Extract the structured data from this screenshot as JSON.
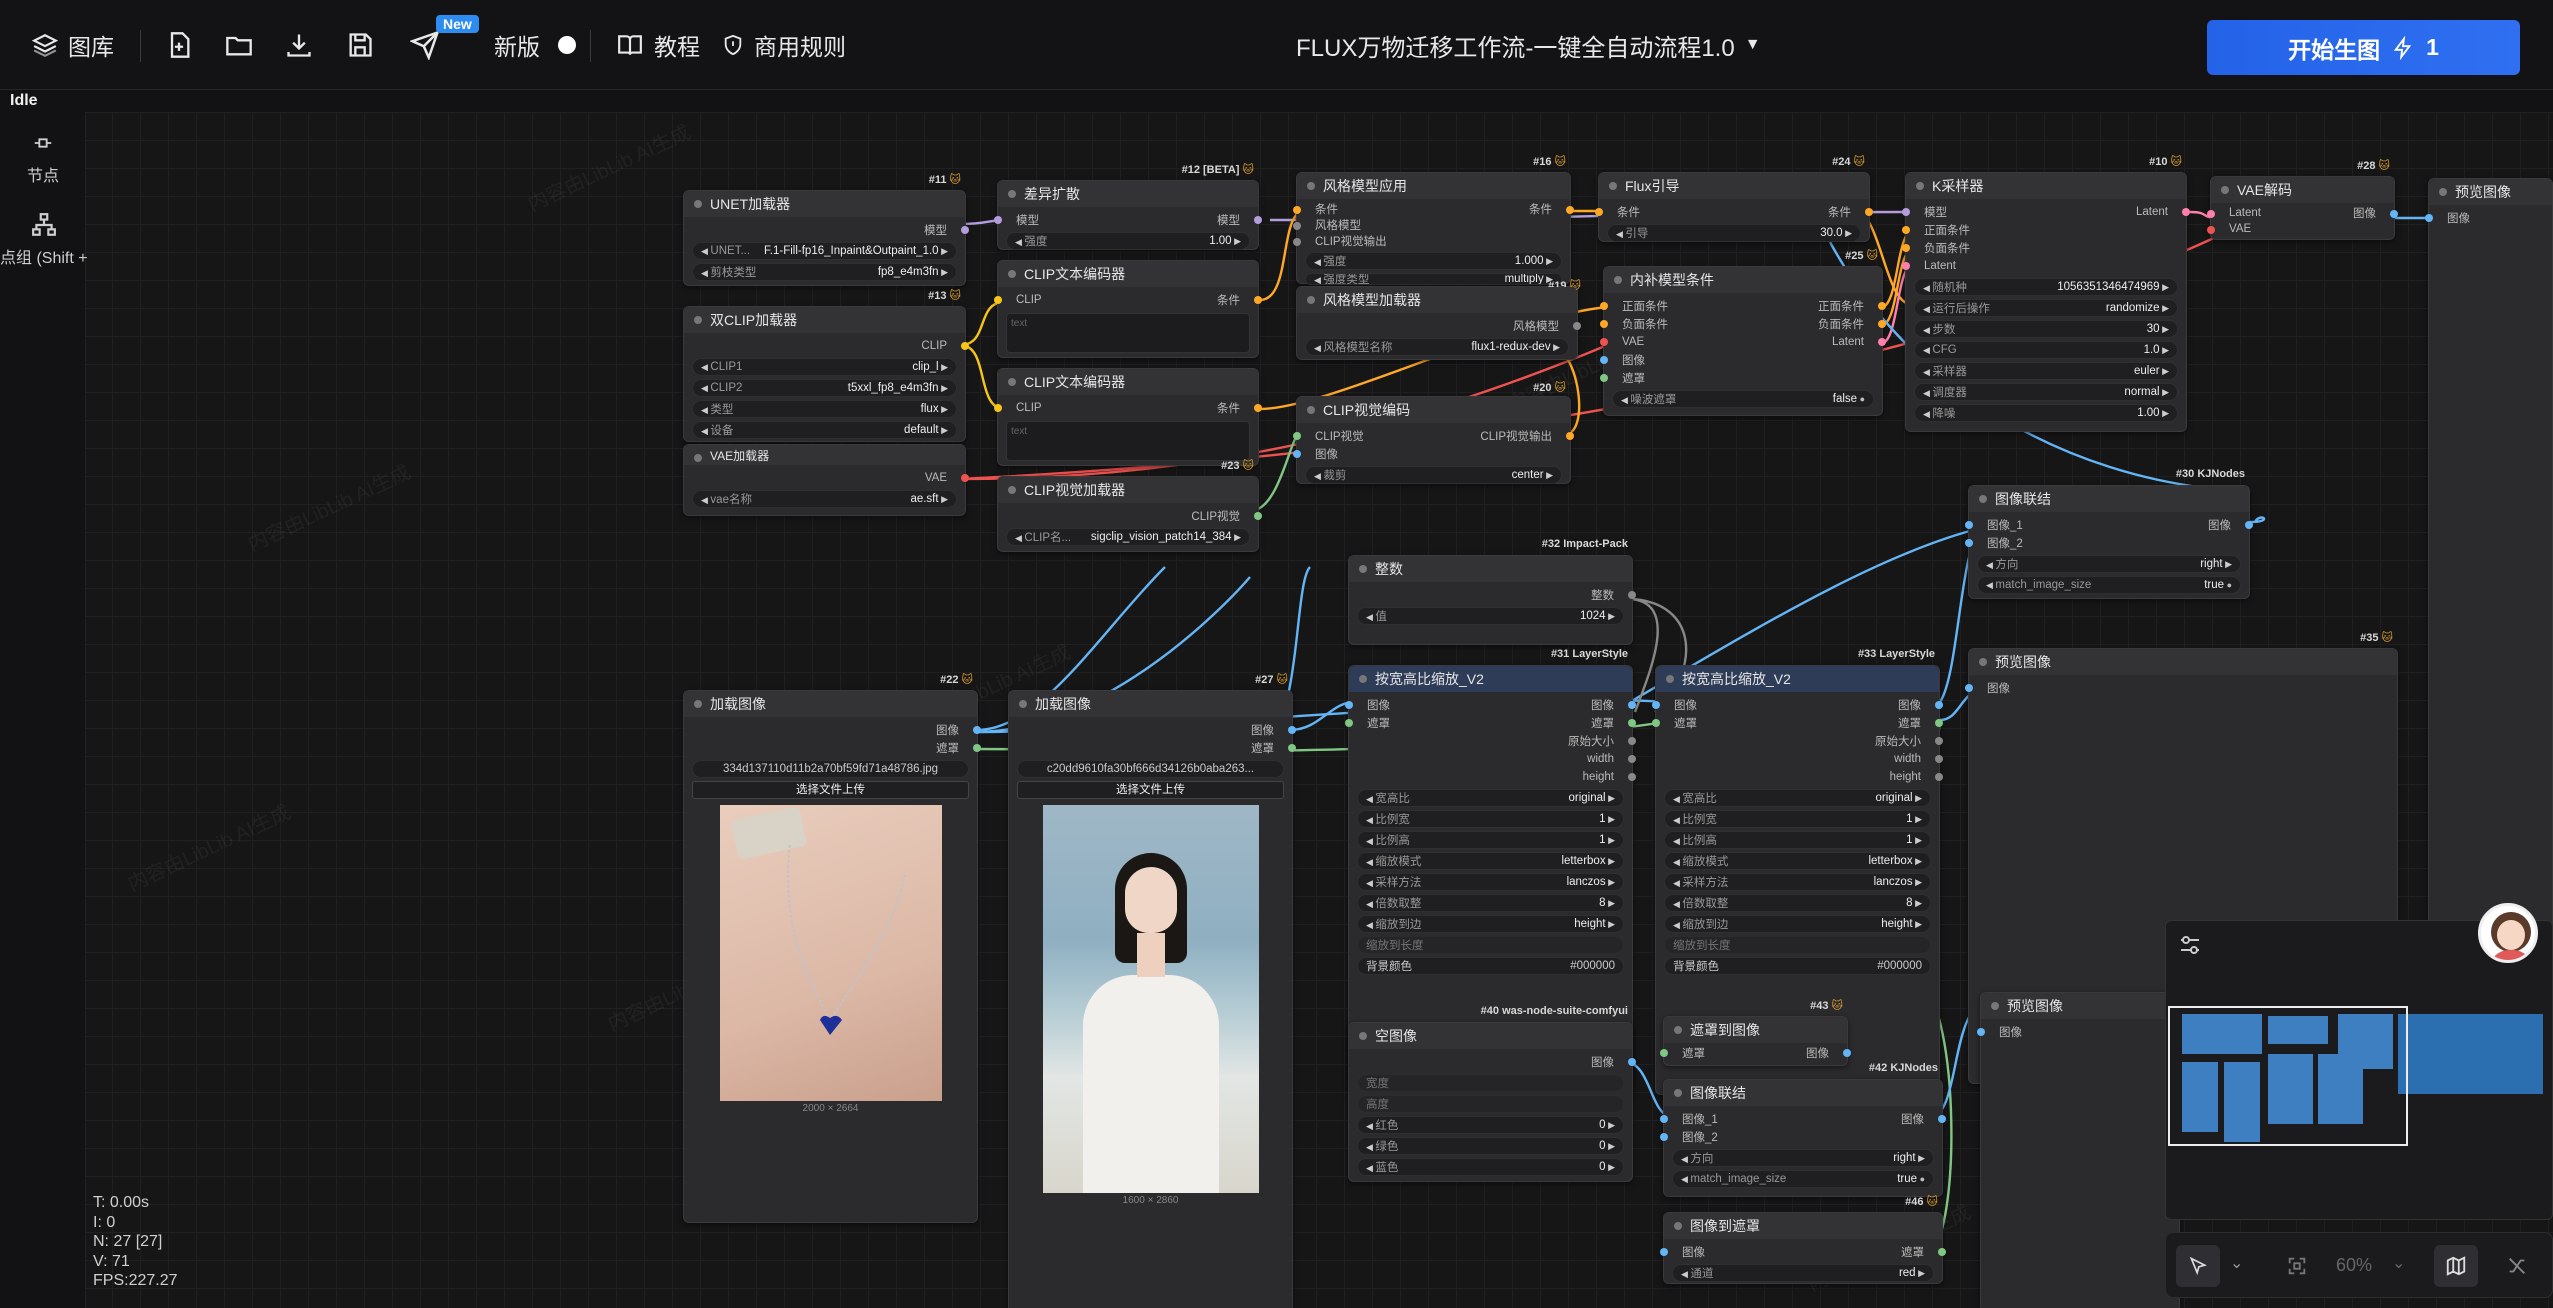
{
  "topbar": {
    "library_label": "图库",
    "new_badge": "New",
    "new_version_label": "新版",
    "tutorial_label": "教程",
    "commercial_label": "商用规则",
    "workflow_title": "FLUX万物迁移工作流-一键全自动流程1.0",
    "run_label": "开始生图",
    "run_count": "1"
  },
  "status": "Idle",
  "leftdock": {
    "nodes_label": "节点",
    "group_label": "点组 (Shift +"
  },
  "stats": {
    "t": "T: 0.00s",
    "i": "I: 0",
    "n": "N: 27 [27]",
    "v": "V: 71",
    "fps": "FPS:227.27"
  },
  "watermark": "内容由LibLib AI生成",
  "nodes": {
    "unet": {
      "id": "#11",
      "title": "UNET加载器",
      "out": "模型",
      "w1k": "UNET...",
      "w1v": "F.1-Fill-fp16_Inpaint&Outpaint_1.0",
      "w2k": "剪枝类型",
      "w2v": "fp8_e4m3fn"
    },
    "dualclip": {
      "id": "#13",
      "title": "双CLIP加载器",
      "out": "CLIP",
      "w1k": "CLIP1",
      "w1v": "clip_l",
      "w2k": "CLIP2",
      "w2v": "t5xxl_fp8_e4m3fn",
      "w3k": "类型",
      "w3v": "flux",
      "w4k": "设备",
      "w4v": "default"
    },
    "vae": {
      "title": "VAE加载器",
      "out": "VAE",
      "wk": "vae名称",
      "wv": "ae.sft"
    },
    "diff": {
      "id": "#12 [BETA]",
      "title": "差异扩散",
      "in": "模型",
      "out": "模型",
      "wk": "强度",
      "wv": "1.00"
    },
    "clipenc1": {
      "title": "CLIP文本编码器",
      "in": "CLIP",
      "out": "条件",
      "ph": "text"
    },
    "clipenc2": {
      "title": "CLIP文本编码器",
      "in": "CLIP",
      "out": "条件",
      "ph": "text"
    },
    "clipvisload": {
      "id": "#23",
      "title": "CLIP视觉加载器",
      "out": "CLIP视觉",
      "wk": "CLIP名...",
      "wv": "sigclip_vision_patch14_384"
    },
    "styleapply": {
      "id": "#16",
      "title": "风格模型应用",
      "in1": "条件",
      "in2": "风格模型",
      "in3": "CLIP视觉输出",
      "out": "条件",
      "w1k": "强度",
      "w1v": "1.000",
      "w2k": "强度类型",
      "w2v": "multiply"
    },
    "styleload": {
      "id": "#19",
      "title": "风格模型加载器",
      "out": "风格模型",
      "wk": "风格模型名称",
      "wv": "flux1-redux-dev"
    },
    "clipvisenc": {
      "id": "#20",
      "title": "CLIP视觉编码",
      "in1": "CLIP视觉",
      "in2": "图像",
      "out": "CLIP视觉输出",
      "wk": "裁剪",
      "wv": "center"
    },
    "flux": {
      "id": "#24",
      "title": "Flux引导",
      "in": "条件",
      "out": "条件",
      "wk": "引导",
      "wv": "30.0"
    },
    "inpaint": {
      "id": "#25",
      "title": "内补模型条件",
      "in1": "正面条件",
      "in2": "负面条件",
      "in3": "VAE",
      "in4": "图像",
      "in5": "遮罩",
      "out1": "正面条件",
      "out2": "负面条件",
      "out3": "Latent",
      "wk": "噪波遮罩",
      "wv": "false"
    },
    "ksampler": {
      "id": "#10",
      "title": "K采样器",
      "in1": "模型",
      "in2": "正面条件",
      "in3": "负面条件",
      "in4": "Latent",
      "out": "Latent",
      "w1k": "随机种",
      "w1v": "1056351346474969",
      "w2k": "运行后操作",
      "w2v": "randomize",
      "w3k": "步数",
      "w3v": "30",
      "w4k": "CFG",
      "w4v": "1.0",
      "w5k": "采样器",
      "w5v": "euler",
      "w6k": "调度器",
      "w6v": "normal",
      "w7k": "降噪",
      "w7v": "1.00"
    },
    "vaedec": {
      "id": "#28",
      "title": "VAE解码",
      "in1": "Latent",
      "in2": "VAE",
      "out": "图像"
    },
    "preview1": {
      "title": "预览图像",
      "in": "图像"
    },
    "imgconcat1": {
      "id": "#30 KJNodes",
      "title": "图像联结",
      "in1": "图像_1",
      "in2": "图像_2",
      "out": "图像",
      "w1k": "方向",
      "w1v": "right",
      "w2k": "match_image_size",
      "w2v": "true"
    },
    "preview2": {
      "id": "#35",
      "title": "预览图像",
      "in": "图像"
    },
    "preview3": {
      "title": "预览图像",
      "in": "图像"
    },
    "int": {
      "id": "#32 Impact-Pack",
      "title": "整数",
      "out": "整数",
      "wk": "值",
      "wv": "1024"
    },
    "load1": {
      "id": "#22",
      "title": "加载图像",
      "out1": "图像",
      "out2": "遮罩",
      "file": "334d137110d11b2a70bf59fd71a48786.jpg",
      "upload": "选择文件上传",
      "size": "2000 × 2664"
    },
    "load2": {
      "id": "#27",
      "title": "加载图像",
      "out1": "图像",
      "out2": "遮罩",
      "file": "c20dd9610fa30bf666d34126b0aba263...",
      "upload": "选择文件上传",
      "size": "1600 × 2860"
    },
    "scale1": {
      "id": "#31 LayerStyle",
      "title": "按宽高比缩放_V2",
      "in1": "图像",
      "in2": "遮罩",
      "o1": "图像",
      "o2": "遮罩",
      "o3": "原始大小",
      "o4": "width",
      "o5": "height",
      "w1k": "宽高比",
      "w1v": "original",
      "w2k": "比例宽",
      "w2v": "1",
      "w3k": "比例高",
      "w3v": "1",
      "w4k": "缩放模式",
      "w4v": "letterbox",
      "w5k": "采样方法",
      "w5v": "lanczos",
      "w6k": "倍数取整",
      "w6v": "8",
      "w7k": "缩放到边",
      "w7v": "height",
      "w8k": "缩放到长度",
      "w9k": "背景颜色",
      "w9v": "#000000"
    },
    "scale2": {
      "id": "#33 LayerStyle",
      "title": "按宽高比缩放_V2",
      "in1": "图像",
      "in2": "遮罩",
      "o1": "图像",
      "o2": "遮罩",
      "o3": "原始大小",
      "o4": "width",
      "o5": "height",
      "w1k": "宽高比",
      "w1v": "original",
      "w2k": "比例宽",
      "w2v": "1",
      "w3k": "比例高",
      "w3v": "1",
      "w4k": "缩放模式",
      "w4v": "letterbox",
      "w5k": "采样方法",
      "w5v": "lanczos",
      "w6k": "倍数取整",
      "w6v": "8",
      "w7k": "缩放到边",
      "w7v": "height",
      "w8k": "缩放到长度",
      "w9k": "背景颜色",
      "w9v": "#000000"
    },
    "empty": {
      "id": "#40 was-node-suite-comfyui",
      "title": "空图像",
      "out": "图像",
      "w1k": "宽度",
      "w2k": "高度",
      "w3k": "红色",
      "w3v": "0",
      "w4k": "绿色",
      "w4v": "0",
      "w5k": "蓝色",
      "w5v": "0"
    },
    "masktoimg": {
      "id": "#43",
      "title": "遮罩到图像",
      "in": "遮罩",
      "out": "图像"
    },
    "imgconcat2": {
      "id": "#42 KJNodes",
      "title": "图像联结",
      "in1": "图像_1",
      "in2": "图像_2",
      "out": "图像",
      "w1k": "方向",
      "w1v": "right",
      "w2k": "match_image_size",
      "w2v": "true"
    },
    "imgtomask": {
      "id": "#46",
      "title": "图像到遮罩",
      "in": "图像",
      "out": "遮罩",
      "wk": "通道",
      "wv": "red"
    }
  },
  "zoom": "60%",
  "colors": {
    "accent": "#2463e8",
    "clip": "#f5c518",
    "model": "#b39ddb",
    "image": "#64b5f6",
    "mask": "#81c784",
    "vae": "#ef5350",
    "latent": "#ff80ab",
    "cond": "#ffa726"
  }
}
